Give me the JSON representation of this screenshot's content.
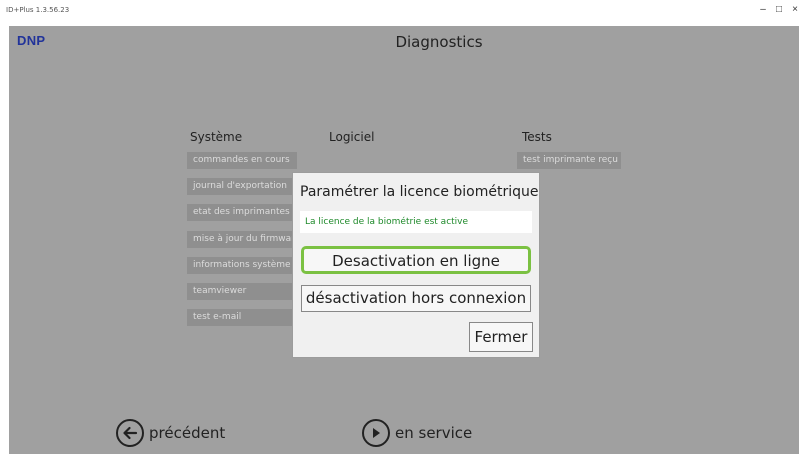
{
  "window": {
    "title": "ID+Plus 1.3.56.23",
    "controls": {
      "minimize": "–",
      "maximize": "□",
      "close": "×"
    }
  },
  "header": {
    "logo": "DNP",
    "title": "Diagnostics"
  },
  "columns": {
    "system": {
      "heading": "Système",
      "items": [
        "commandes en cours",
        "journal d'exportation",
        "etat des imprimantes",
        "mise à jour du firmware",
        "informations système",
        "teamviewer",
        "test e-mail"
      ]
    },
    "software": {
      "heading": "Logiciel"
    },
    "tests": {
      "heading": "Tests",
      "items": [
        "test imprimante reçu"
      ]
    }
  },
  "dialog": {
    "title": "Paramétrer la licence biométrique",
    "status": "La licence de la biométrie est active",
    "status_color": "#1f8a2b",
    "highlight_color": "#7bc142",
    "online_button": "Desactivation en ligne",
    "offline_button": "désactivation hors connexion",
    "close_button": "Fermer"
  },
  "nav": {
    "previous": {
      "label": "précédent",
      "icon": "arrow-left-icon"
    },
    "service": {
      "label": "en service",
      "icon": "play-icon"
    }
  }
}
